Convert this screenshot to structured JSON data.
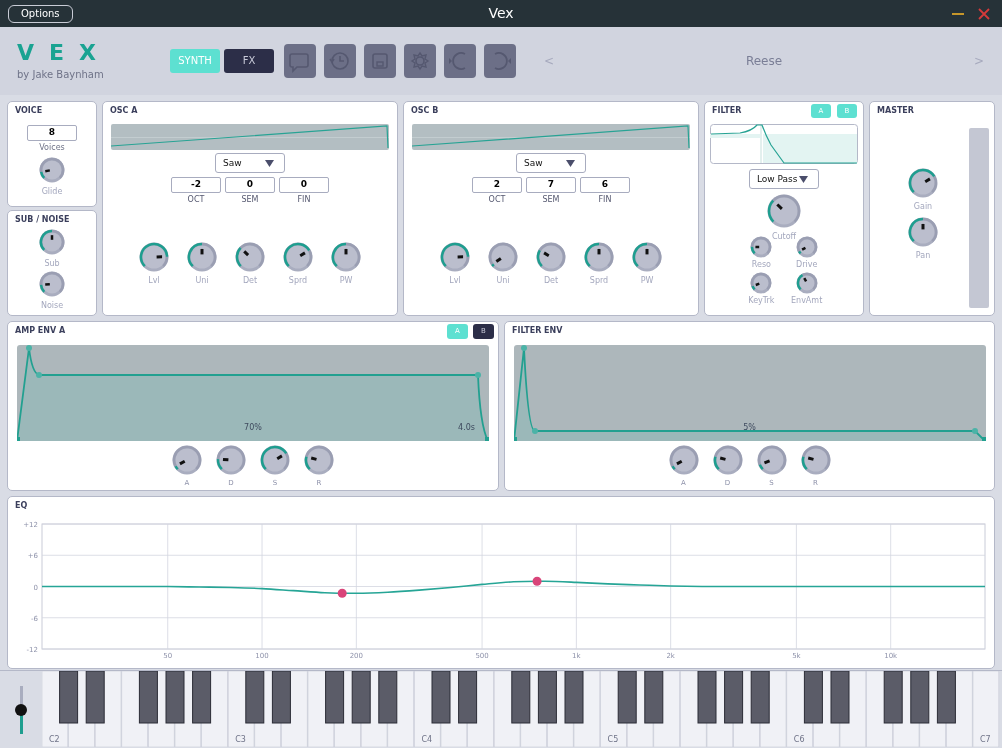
{
  "window": {
    "title": "Vex",
    "options_button": "Options"
  },
  "header": {
    "logo": "VEX",
    "byline": "by Jake Baynham",
    "tabs": [
      {
        "label": "SYNTH",
        "selected": true
      },
      {
        "label": "FX",
        "selected": false
      }
    ],
    "preset": {
      "prev": "<",
      "name": "Reese",
      "next": ">"
    }
  },
  "voice": {
    "title": "VOICE",
    "voices": "8",
    "voices_label": "Voices",
    "knobs": [
      {
        "label": "Glide"
      }
    ]
  },
  "sub_noise": {
    "title": "SUB / NOISE",
    "knobs": [
      {
        "label": "Sub"
      },
      {
        "label": "Noise"
      }
    ]
  },
  "oscillators": [
    {
      "title": "OSC A",
      "waveform": "Saw",
      "fields": [
        {
          "label": "OCT",
          "value": "-2"
        },
        {
          "label": "SEM",
          "value": "0"
        },
        {
          "label": "FIN",
          "value": "0"
        }
      ],
      "knobs": [
        {
          "label": "Lvl"
        },
        {
          "label": "Uni"
        },
        {
          "label": "Det"
        },
        {
          "label": "Sprd"
        },
        {
          "label": "PW"
        }
      ]
    },
    {
      "title": "OSC B",
      "waveform": "Saw",
      "fields": [
        {
          "label": "OCT",
          "value": "2"
        },
        {
          "label": "SEM",
          "value": "7"
        },
        {
          "label": "FIN",
          "value": "6"
        }
      ],
      "knobs": [
        {
          "label": "Lvl"
        },
        {
          "label": "Uni"
        },
        {
          "label": "Det"
        },
        {
          "label": "Sprd"
        },
        {
          "label": "PW"
        }
      ]
    }
  ],
  "filter": {
    "title": "FILTER",
    "toggles": [
      {
        "label": "A",
        "on": true
      },
      {
        "label": "B",
        "on": true
      }
    ],
    "type": "Low Pass",
    "cutoff": {
      "label": "Cutoff"
    },
    "knobs": [
      {
        "label": "Reso"
      },
      {
        "label": "Drive"
      },
      {
        "label": "KeyTrk"
      },
      {
        "label": "EnvAmt"
      }
    ]
  },
  "master": {
    "title": "MASTER",
    "knobs": [
      {
        "label": "Gain"
      },
      {
        "label": "Pan"
      }
    ]
  },
  "envelopes": [
    {
      "title": "AMP ENV A",
      "kind": "amp",
      "toggles": [
        {
          "label": "A",
          "selected": true
        },
        {
          "label": "B",
          "selected": false
        }
      ],
      "graph_labels": [
        {
          "kind": "sustain",
          "text": "70%"
        },
        {
          "kind": "release",
          "text": "4.0s"
        }
      ],
      "knobs": [
        {
          "label": "A"
        },
        {
          "label": "D"
        },
        {
          "label": "S"
        },
        {
          "label": "R"
        }
      ]
    },
    {
      "title": "FILTER ENV",
      "kind": "filter",
      "graph_labels": [
        {
          "kind": "sustain",
          "text": "5%"
        }
      ],
      "knobs": [
        {
          "label": "A"
        },
        {
          "label": "D"
        },
        {
          "label": "S"
        },
        {
          "label": "R"
        }
      ]
    }
  ],
  "eq": {
    "title": "EQ",
    "chart_data": {
      "type": "line",
      "categories": [
        null,
        null,
        null,
        null,
        "50",
        null,
        null,
        "100",
        null,
        null,
        "200",
        null,
        null,
        null,
        "500",
        null,
        null,
        "1k",
        null,
        null,
        "2k",
        null,
        null,
        null,
        "5k",
        null,
        null,
        "10k",
        null,
        null,
        null
      ],
      "series": [
        {
          "color": "#26a596",
          "values": [
            0,
            0,
            0,
            0,
            0,
            -0.1,
            -0.2,
            -0.4,
            -0.8,
            -1.2,
            -1.3,
            -1.1,
            -0.7,
            -0.2,
            0.4,
            0.9,
            1,
            0.8,
            0.5,
            0.3,
            0.1,
            0,
            0,
            0,
            0,
            0,
            0,
            0,
            0,
            0,
            0
          ]
        }
      ],
      "ylim": [
        -12,
        12
      ],
      "grid": true,
      "yticks": [
        {
          "value": 12,
          "label": "+12"
        },
        {
          "value": 6,
          "label": "+6"
        },
        {
          "value": 0,
          "label": "0"
        },
        {
          "value": -6,
          "label": "-6"
        },
        {
          "value": -12,
          "label": "-12"
        }
      ]
    }
  },
  "keyboard": {
    "wheel": {
      "level": 0.5
    },
    "octave_labels": [
      "C2",
      "C3",
      "C4",
      "C5",
      "C6",
      "C7"
    ]
  }
}
